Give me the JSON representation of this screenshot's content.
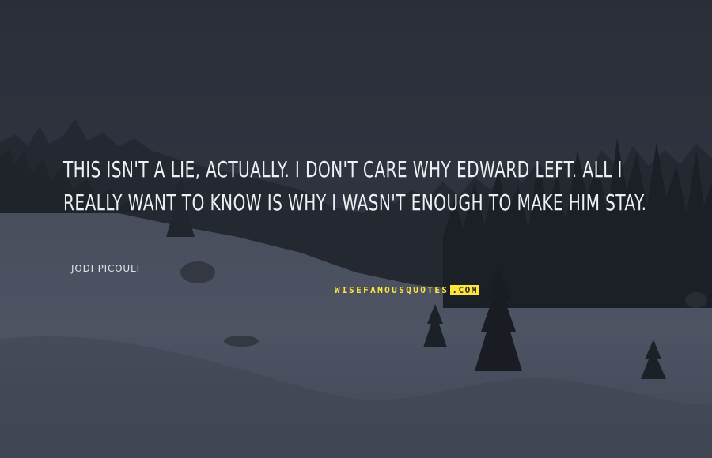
{
  "quote": {
    "text": "THIS ISN'T A LIE, ACTUALLY. I DON'T CARE WHY EDWARD LEFT. ALL I REALLY WANT TO KNOW IS WHY I WASN'T ENOUGH TO MAKE HIM STAY.",
    "author": "JODI PICOULT"
  },
  "watermark": {
    "main": "WISEFAMOUSQUOTES",
    "suffix": ".COM"
  },
  "colors": {
    "sky": "#2f3440",
    "snow": "#5b6274",
    "trees": "#1c2128",
    "text": "#eef0f4",
    "watermark": "#ffe53b"
  }
}
